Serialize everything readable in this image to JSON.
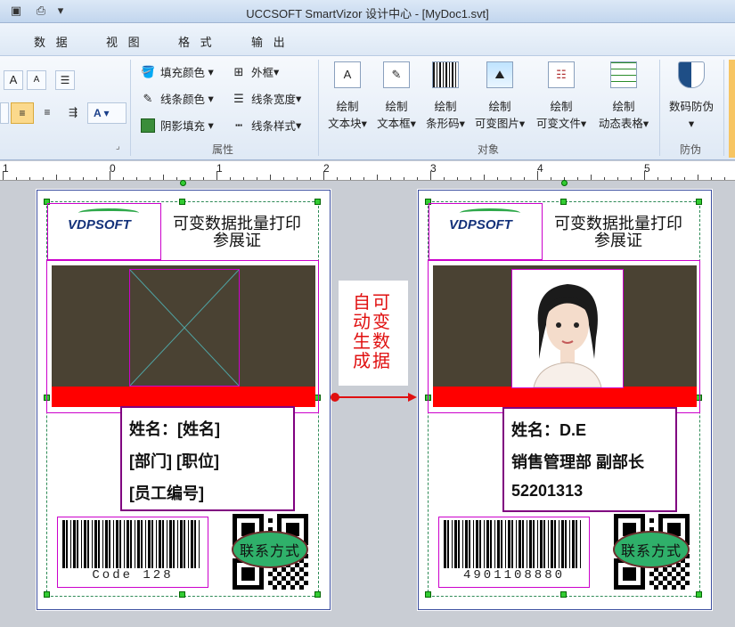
{
  "window": {
    "title": "UCCSOFT SmartVizor 设计中心 - [MyDoc1.svt]"
  },
  "menu": {
    "items": [
      "数 据",
      "视 图",
      "格 式",
      "输 出"
    ]
  },
  "ribbon": {
    "attributes": {
      "fill_color": "填充颜色",
      "border": "外框",
      "line_color": "线条颜色",
      "line_width": "线条宽度",
      "shadow_fill": "阴影填充",
      "line_style": "线条样式",
      "group_label": "属性"
    },
    "objects": {
      "draw_label": "绘制",
      "buttons": [
        "文本块",
        "文本框",
        "条形码",
        "可变图片",
        "可变文件",
        "动态表格"
      ],
      "group_label": "对象"
    },
    "security": {
      "button": "数码防伪",
      "group_label": "防伪"
    }
  },
  "ruler": {
    "numbers": [
      "1",
      "0",
      "1",
      "2",
      "3",
      "4",
      "5"
    ]
  },
  "left_card": {
    "logo": "VDPSOFT",
    "title_line1": "可变数据批量打印",
    "title_line2": "参展证",
    "name_line": "姓名：[姓名]",
    "dept_line": "[部门]  [职位]",
    "id_line": "[员工编号]",
    "barcode_text": "Code 128",
    "contact_label": "联系方式"
  },
  "right_card": {
    "logo": "VDPSOFT",
    "title_line1": "可变数据批量打印",
    "title_line2": "参展证",
    "name_line": "姓名：D.E",
    "dept_line": "销售管理部  副部长",
    "id_line": "52201313",
    "barcode_text": "4901108880",
    "contact_label": "联系方式"
  },
  "arrow_label": {
    "line1": "自可",
    "line2": "动变",
    "line3": "生数",
    "line4": "成据"
  },
  "colors": {
    "accent_red": "#ff0000",
    "photo_bg": "#4a4233",
    "contact_oval": "#2fb06a",
    "frame_magenta": "#cc00cc"
  }
}
